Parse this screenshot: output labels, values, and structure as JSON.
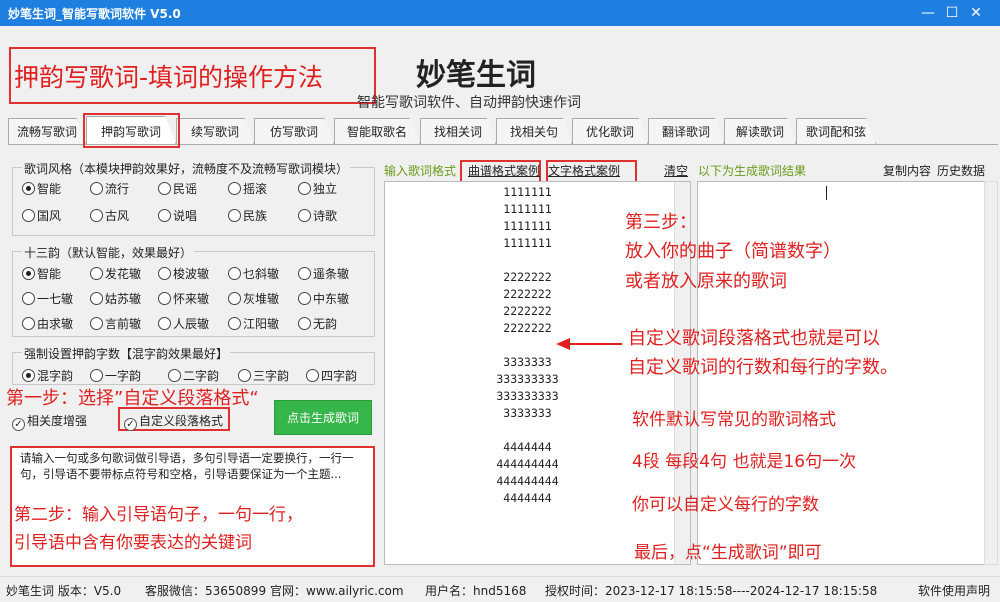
{
  "window": {
    "title": "妙笔生词_智能写歌词软件 V5.0",
    "minimize": "—",
    "maximize": "☐",
    "close": "✕"
  },
  "header": {
    "logo": "妙笔生词",
    "slogan": "智能写歌词软件、自动押韵快速作词",
    "annotation_title": "押韵写歌词-填词的操作方法"
  },
  "tabs": [
    "流畅写歌词",
    "押韵写歌词",
    "续写歌词",
    "仿写歌词",
    "智能取歌名",
    "找相关词",
    "找相关句",
    "优化歌词",
    "翻译歌词",
    "解读歌词",
    "歌词配和弦"
  ],
  "active_tab": "押韵写歌词",
  "style_group": {
    "title": "歌词风格（本模块押韵效果好，流畅度不及流畅写歌词模块）",
    "options": [
      "智能",
      "流行",
      "民谣",
      "摇滚",
      "独立",
      "国风",
      "古风",
      "说唱",
      "民族",
      "诗歌"
    ],
    "selected": "智能"
  },
  "rhyme_group": {
    "title": "十三韵（默认智能，效果最好）",
    "options": [
      "智能",
      "发花辙",
      "梭波辙",
      "乜斜辙",
      "遥条辙",
      "一七辙",
      "姑苏辙",
      "怀来辙",
      "灰堆辙",
      "中东辙",
      "由求辙",
      "言前辙",
      "人辰辙",
      "江阳辙",
      "无韵"
    ],
    "selected": "智能"
  },
  "count_group": {
    "title": "强制设置押韵字数【混字韵效果最好】",
    "options": [
      "混字韵",
      "一字韵",
      "二字韵",
      "三字韵",
      "四字韵"
    ],
    "selected": "混字韵"
  },
  "checks": {
    "relevance": "相关度增强",
    "custom_format": "自定义段落格式"
  },
  "generate_button": "点击生成歌词",
  "guide_placeholder": "请输入一句或多句歌词做引导语，多句引导语一定要换行，一行一句，引导语不要带标点符号和空格，引导语要保证为一个主题...",
  "input_bar": {
    "label": "输入歌词格式",
    "tune_example": "曲谱格式案例",
    "text_example": "文字格式案例",
    "clear": "清空",
    "result_label": "以下为生成歌词结果",
    "copy": "复制内容",
    "history": "历史数据"
  },
  "input_lines": [
    "1111111",
    "1111111",
    "1111111",
    "1111111",
    "",
    "2222222",
    "2222222",
    "2222222",
    "2222222",
    "",
    "3333333",
    "333333333",
    "333333333",
    "3333333",
    "",
    "4444444",
    "444444444",
    "444444444",
    "4444444"
  ],
  "annotations": {
    "step1": "第一步：选择”自定义段落格式“",
    "step2_line1": "第二步：输入引导语句子，一句一行，",
    "step2_line2": "引导语中含有你要表达的关键词",
    "step3_title": "第三步：",
    "step3_line1": "放入你的曲子（简谱数字）",
    "step3_line2": "或者放入原来的歌词",
    "custom_line1": "自定义歌词段落格式也就是可以",
    "custom_line2": "自定义歌词的行数和每行的字数。",
    "default_format": "软件默认写常见的歌词格式",
    "segments": "4段 每段4句  也就是16句一次",
    "per_line": "你可以自定义每行的字数",
    "finally": "最后，点“生成歌词”即可"
  },
  "status": {
    "name": "妙笔生词 版本：V5.0",
    "wechat": "客服微信：53650899",
    "website": "官网：www.ailyric.com",
    "user": "用户名：hnd5168",
    "auth": "授权时间：2023-12-17 18:15:58----2024-12-17 18:15:58",
    "terms": "软件使用声明"
  },
  "colors": {
    "titlebar": "#1e7fe0",
    "annotation_red": "#e02020",
    "generate_green": "#35b54a",
    "result_label": "#6a9a1a"
  }
}
